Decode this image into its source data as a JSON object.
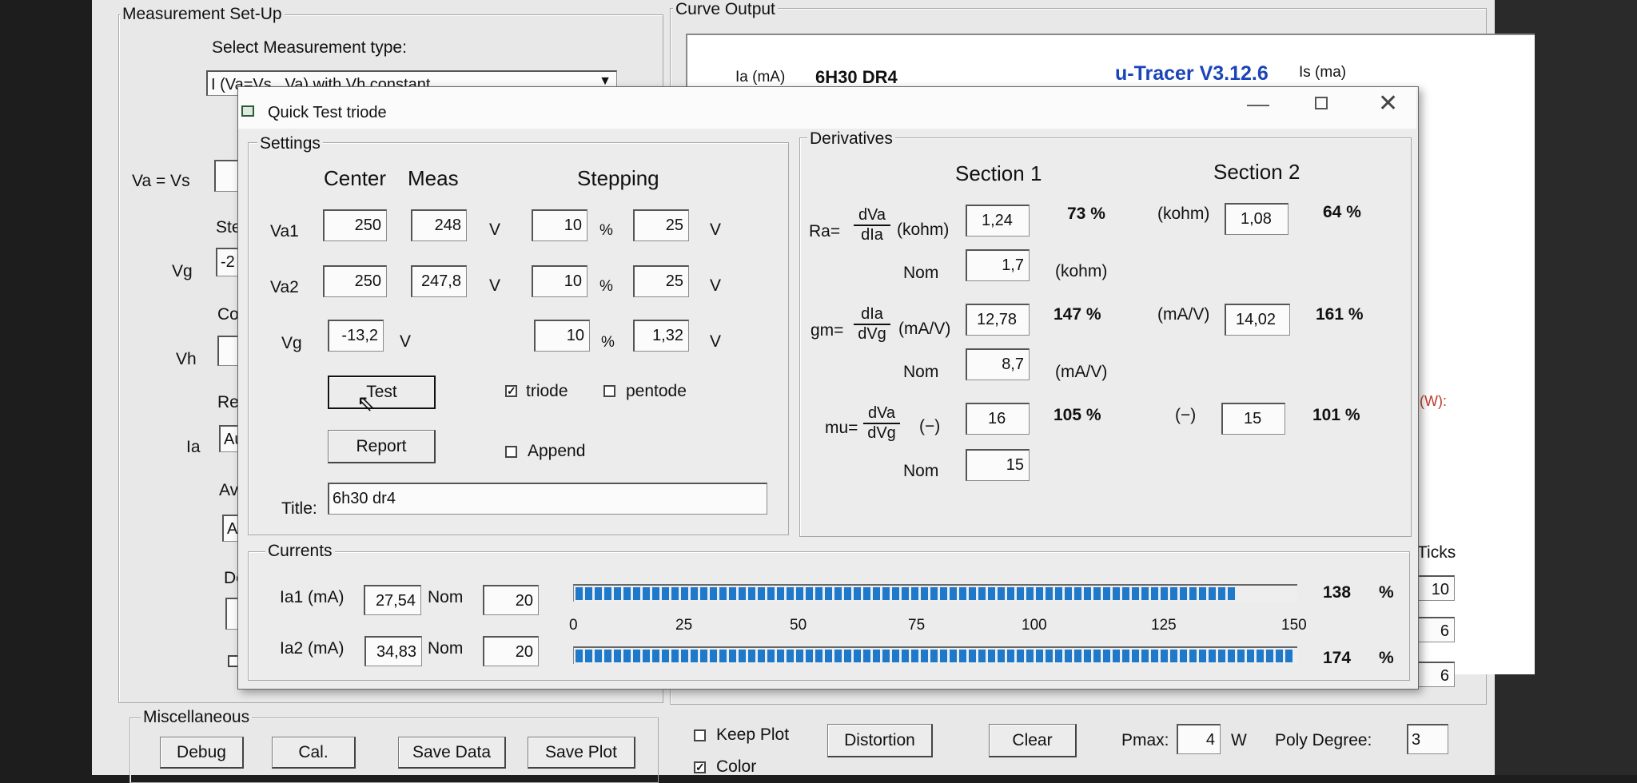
{
  "main": {
    "measurement_setup": {
      "title": "Measurement Set-Up",
      "select_label": "Select Measurement type:",
      "select_value": "I (Va=Vs , Va) with Vh constant",
      "va_vs_label": "Va = Vs",
      "ste_label": "Ste",
      "vg_label": "Vg",
      "vg_value": "-2",
      "co_label": "Co",
      "vh_label": "Vh",
      "re_label": "Re",
      "ia_label": "Ia",
      "ia_value": "Au",
      "av_label": "Av",
      "av_value": "Au",
      "de_label": "De"
    },
    "curve_output": {
      "title": "Curve Output",
      "ia_unit": "Ia (mA)",
      "tube_name": "6H30 DR4",
      "app_version": "u-Tracer V3.12.6",
      "is_unit": "Is (ma)",
      "w_fragment": "(W):",
      "ticks_label": "Ticks",
      "ticks_values": [
        "10",
        "6",
        "6"
      ]
    },
    "misc": {
      "title": "Miscellaneous",
      "debug": "Debug",
      "cal": "Cal.",
      "save_data": "Save Data",
      "save_plot": "Save Plot"
    },
    "bottom": {
      "keep_plot": "Keep Plot",
      "color": "Color",
      "distortion": "Distortion",
      "clear": "Clear",
      "pmax_label": "Pmax:",
      "pmax_value": "4",
      "pmax_unit": "W",
      "poly_label": "Poly Degree:",
      "poly_value": "3"
    }
  },
  "dialog": {
    "title": "Quick Test triode",
    "settings": {
      "title": "Settings",
      "col_center": "Center",
      "col_meas": "Meas",
      "col_stepping": "Stepping",
      "rows": [
        {
          "label": "Va1",
          "center": "250",
          "meas": "248",
          "unit": "V",
          "step_pct": "10",
          "pct": "%",
          "step_abs": "25",
          "abs_unit": "V"
        },
        {
          "label": "Va2",
          "center": "250",
          "meas": "247,8",
          "unit": "V",
          "step_pct": "10",
          "pct": "%",
          "step_abs": "25",
          "abs_unit": "V"
        },
        {
          "label": "Vg",
          "center": "-13,2",
          "meas": "",
          "unit": "V",
          "step_pct": "10",
          "pct": "%",
          "step_abs": "1,32",
          "abs_unit": "V"
        }
      ],
      "test_button": "Test",
      "report_button": "Report",
      "triode": "triode",
      "pentode": "pentode",
      "append": "Append",
      "title_label": "Title:",
      "title_value": "6h30 dr4"
    },
    "derivatives": {
      "title": "Derivatives",
      "section1": "Section 1",
      "section2": "Section 2",
      "ra": {
        "label": "Ra=",
        "num": "dVa",
        "den": "dIa",
        "unit": "(kohm)",
        "s1": "1,24",
        "s1_pct": "73 %",
        "s2_unit": "(kohm)",
        "s2": "1,08",
        "s2_pct": "64 %",
        "nom_label": "Nom",
        "nom": "1,7",
        "nom_unit": "(kohm)"
      },
      "gm": {
        "label": "gm=",
        "num": "dIa",
        "den": "dVg",
        "unit": "(mA/V)",
        "s1": "12,78",
        "s1_pct": "147 %",
        "s2_unit": "(mA/V)",
        "s2": "14,02",
        "s2_pct": "161 %",
        "nom_label": "Nom",
        "nom": "8,7",
        "nom_unit": "(mA/V)"
      },
      "mu": {
        "label": "mu=",
        "num": "dVa",
        "den": "dVg",
        "unit": "(−)",
        "s1": "16",
        "s1_pct": "105 %",
        "s2_unit": "(−)",
        "s2": "15",
        "s2_pct": "101 %",
        "nom_label": "Nom",
        "nom": "15"
      }
    },
    "currents": {
      "title": "Currents",
      "ia1_label": "Ia1 (mA)",
      "ia1_value": "27,54",
      "ia1_nom_label": "Nom",
      "ia1_nom": "20",
      "ia1_pct": "138",
      "ia2_label": "Ia2 (mA)",
      "ia2_value": "34,83",
      "ia2_nom_label": "Nom",
      "ia2_nom": "20",
      "ia2_pct": "174",
      "pct_sign": "%",
      "scale_ticks": [
        "0",
        "25",
        "50",
        "75",
        "100",
        "125",
        "150"
      ]
    }
  }
}
